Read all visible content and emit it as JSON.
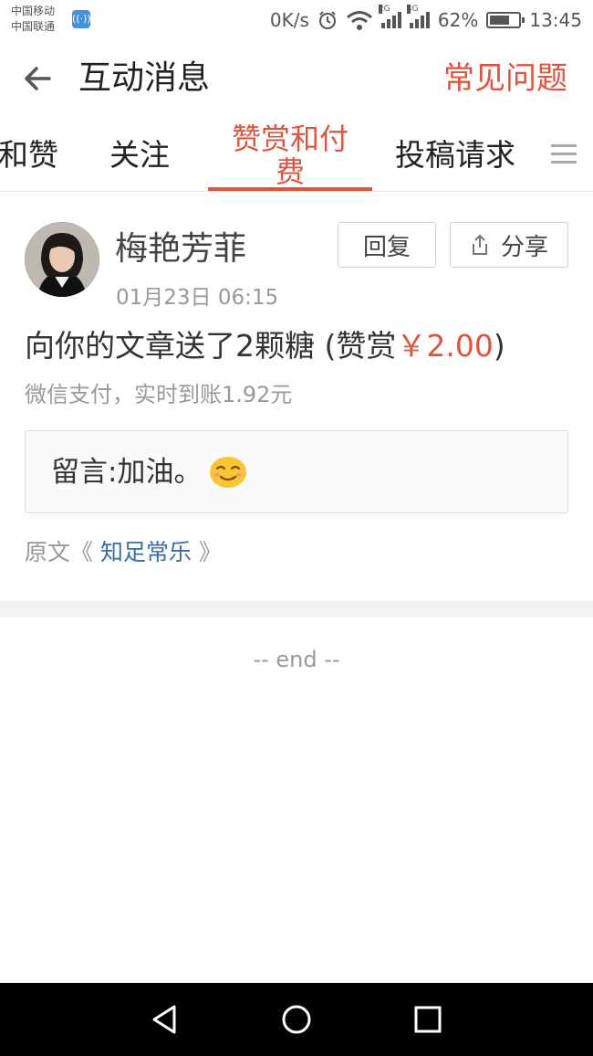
{
  "status_bar": {
    "carrier_1": "中国移动",
    "carrier_2": "中国联通",
    "net_speed": "0K/s",
    "net_2g": "2G",
    "net_4g": "4G",
    "battery_percent": "62%",
    "battery_level": 0.62,
    "time": "13:45"
  },
  "header": {
    "title": "互动消息",
    "faq_label": "常见问题"
  },
  "tabs": [
    {
      "label": "和赞",
      "active": false
    },
    {
      "label": "关注",
      "active": false
    },
    {
      "label_line1": "赞赏和付",
      "label_line2": "费",
      "active": true
    },
    {
      "label": "投稿请求",
      "active": false
    }
  ],
  "message": {
    "user_name": "梅艳芳菲",
    "datetime": "01月23日 06:15",
    "reply_label": "回复",
    "share_label": "分享",
    "text_prefix": "向你的文章送了2颗糖 (赞赏",
    "amount": "￥2.00",
    "text_suffix": ")",
    "pay_info": "微信支付，实时到账1.92元",
    "comment": "留言:加油。",
    "origin_prefix": "原文《",
    "origin_title": " 知足常乐 ",
    "origin_suffix": "》"
  },
  "footer": {
    "end_text": "-- end --"
  },
  "colors": {
    "accent": "#e0533f",
    "link": "#3a6ea5"
  }
}
